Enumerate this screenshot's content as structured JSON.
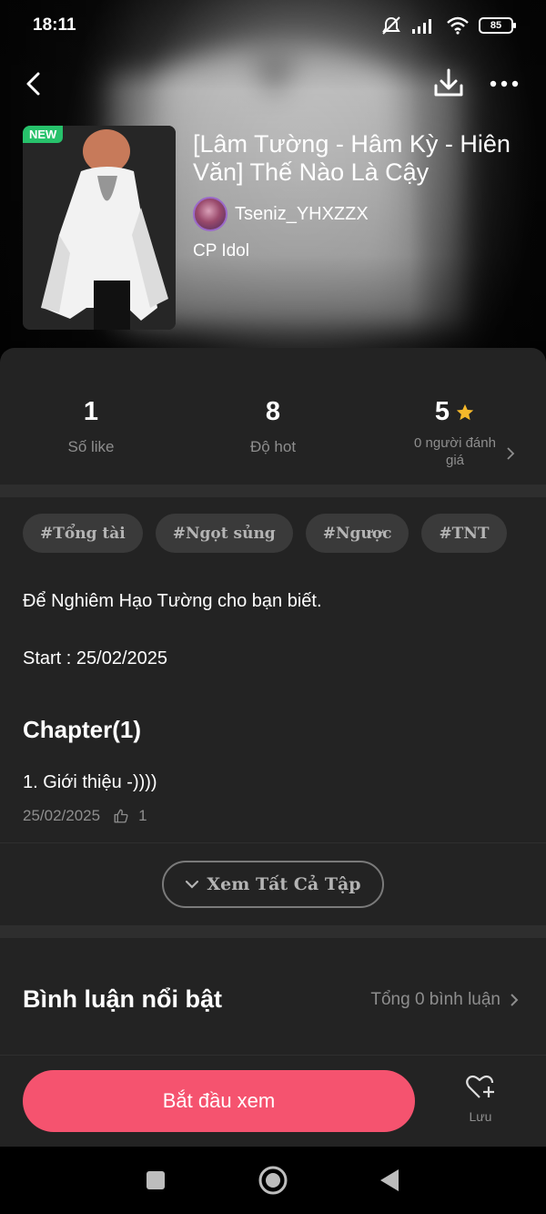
{
  "status_bar": {
    "time": "18:11",
    "battery": "85"
  },
  "book": {
    "badge": "NEW",
    "title": "[Lâm Tường - Hâm Kỳ - Hiên Văn] Thế Nào Là Cậy",
    "author": "Tseniz_YHXZZX",
    "category": "CP Idol"
  },
  "stats": {
    "likes": {
      "value": "1",
      "label": "Số like"
    },
    "hot": {
      "value": "8",
      "label": "Độ hot"
    },
    "rating": {
      "value": "5",
      "label": "0 người đánh giá"
    }
  },
  "tags": [
    "#Tổng tài",
    "#Ngọt sủng",
    "#Ngược",
    "#TNT"
  ],
  "description": {
    "line1": "Để Nghiêm Hạo Tường cho bạn biết.",
    "line2": "Start : 25/02/2025"
  },
  "chapters": {
    "heading": "Chapter(1)",
    "items": [
      {
        "title": "1. Giới thiệu -))))",
        "date": "25/02/2025",
        "likes": "1"
      }
    ],
    "see_all_label": "Xem Tất Cả Tập"
  },
  "comments": {
    "title": "Bình luận nổi bật",
    "total": "Tổng 0 bình luận"
  },
  "actions": {
    "start_label": "Bắt đầu xem",
    "save_label": "Lưu"
  },
  "colors": {
    "accent": "#f5536f",
    "badge": "#27c26b",
    "star": "#f5b82a",
    "background": "#232323"
  },
  "icons": [
    "back-arrow-icon",
    "download-icon",
    "more-dots-icon",
    "star-icon",
    "chevron-right-icon",
    "thumbs-up-icon",
    "chevron-down-icon",
    "heart-plus-icon",
    "nav-square-icon",
    "nav-home-icon",
    "nav-back-icon",
    "mute-icon",
    "signal-icon",
    "wifi-icon"
  ]
}
